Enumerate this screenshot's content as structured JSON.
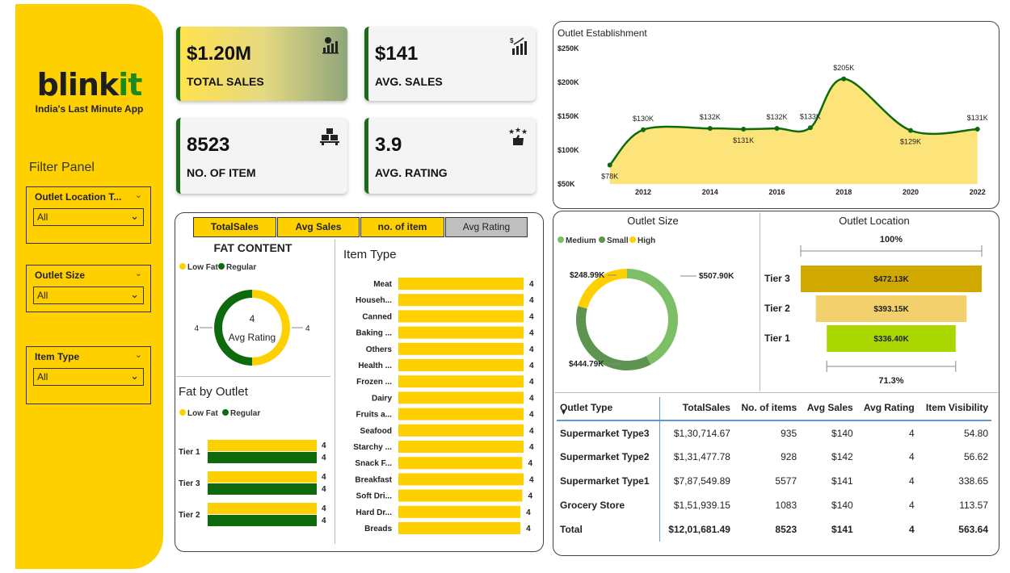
{
  "brand": {
    "name_a": "blink",
    "name_b": "it",
    "tagline": "India's Last Minute App"
  },
  "filters": {
    "title": "Filter Panel",
    "slicers": [
      {
        "label": "Outlet Location T...",
        "value": "All"
      },
      {
        "label": "Outlet Size",
        "value": "All"
      },
      {
        "label": "Item Type",
        "value": "All"
      }
    ]
  },
  "kpis": [
    {
      "value": "$1.20M",
      "label": "TOTAL SALES",
      "icon": "sales-growth-icon"
    },
    {
      "value": "$141",
      "label": "AVG. SALES",
      "icon": "dollar-bar-chart-icon"
    },
    {
      "value": "8523",
      "label": "NO. OF ITEM",
      "icon": "boxes-icon"
    },
    {
      "value": "3.9",
      "label": "AVG. RATING",
      "icon": "thumbs-up-stars-icon"
    }
  ],
  "measure_buttons": [
    "TotalSales",
    "Avg Sales",
    "no. of item",
    "Avg Rating"
  ],
  "selected_measure": "Avg Rating",
  "colors": {
    "yellow": "#ffd000",
    "green": "#0d6b0d",
    "area": "#fde47a",
    "line": "#0d6b0d"
  },
  "chart_data": [
    {
      "id": "outlet_establishment",
      "type": "area",
      "title": "Outlet Establishment",
      "x": [
        2011,
        2012,
        2014,
        2015,
        2016,
        2017,
        2018,
        2020,
        2022
      ],
      "values": [
        78,
        130,
        132,
        131,
        132,
        133,
        205,
        129,
        131
      ],
      "value_labels": [
        "$78K",
        "$130K",
        "$132K",
        "$131K",
        "$132K",
        "$133K",
        "$205K",
        "$129K",
        "$131K"
      ],
      "label_position": [
        "below",
        "above",
        "above",
        "below",
        "above",
        "above",
        "above",
        "below",
        "above"
      ],
      "x_ticks": [
        "2012",
        "2014",
        "2016",
        "2018",
        "2020",
        "2022"
      ],
      "x_tick_values": [
        2012,
        2014,
        2016,
        2018,
        2020,
        2022
      ],
      "y_ticks": [
        "$250K",
        "$200K",
        "$150K",
        "$100K",
        "$50K"
      ],
      "y_tick_values": [
        250,
        200,
        150,
        100,
        50
      ],
      "ylim": [
        50,
        250
      ],
      "xlim": [
        2010.5,
        2022.2
      ]
    },
    {
      "id": "fat_content",
      "type": "pie",
      "title": "FAT CONTENT",
      "series": [
        {
          "name": "Low Fat",
          "value": 4
        },
        {
          "name": "Regular",
          "value": 4
        }
      ],
      "center_value": "4",
      "center_label": "Avg Rating",
      "side_labels": [
        "4",
        "4"
      ]
    },
    {
      "id": "outlet_size",
      "type": "pie",
      "title": "Outlet Size",
      "series": [
        {
          "name": "Medium",
          "value": 507.9,
          "label": "$507.90K",
          "color": "#7dbf66"
        },
        {
          "name": "Small",
          "value": 444.79,
          "label": "$444.79K",
          "color": "#5c9450"
        },
        {
          "name": "High",
          "value": 248.99,
          "label": "$248.99K",
          "color": "#ffd000"
        }
      ]
    },
    {
      "id": "outlet_location",
      "type": "bar",
      "title": "Outlet Location",
      "categories": [
        "Tier 3",
        "Tier 2",
        "Tier 1"
      ],
      "values": [
        472.13,
        393.15,
        336.4
      ],
      "value_labels": [
        "$472.13K",
        "$393.15K",
        "$336.40K"
      ],
      "colors": [
        "#cfa800",
        "#f2d06b",
        "#aad700"
      ],
      "top_label": "100%",
      "bottom_label": "71.3%"
    },
    {
      "id": "fat_by_outlet",
      "type": "bar",
      "title": "Fat by Outlet",
      "categories": [
        "Tier 1",
        "Tier 3",
        "Tier 2"
      ],
      "series": [
        {
          "name": "Low Fat",
          "values": [
            4,
            4,
            4
          ]
        },
        {
          "name": "Regular",
          "values": [
            4,
            4,
            4
          ]
        }
      ],
      "xlim": [
        0,
        4
      ]
    },
    {
      "id": "item_type",
      "type": "bar",
      "title": "Item Type",
      "categories": [
        "Meat",
        "Househ...",
        "Canned",
        "Baking ...",
        "Others",
        "Health ...",
        "Frozen ...",
        "Dairy",
        "Fruits a...",
        "Seafood",
        "Starchy ...",
        "Snack F...",
        "Breakfast",
        "Soft Dri...",
        "Hard Dr...",
        "Breads"
      ],
      "values": [
        4,
        4,
        4,
        4,
        4,
        4,
        4,
        4,
        4,
        4,
        4,
        4,
        4,
        4,
        4,
        4
      ],
      "ratios": [
        1.0,
        1.0,
        1.0,
        1.0,
        1.0,
        1.0,
        1.0,
        1.0,
        1.0,
        1.0,
        1.0,
        0.99,
        1.0,
        0.99,
        0.975,
        0.975
      ]
    }
  ],
  "outlet_table": {
    "headers": [
      "Outlet Type",
      "TotalSales",
      "No. of items",
      "Avg Sales",
      "Avg Rating",
      "Item Visibility"
    ],
    "rows": [
      [
        "Supermarket Type3",
        "$1,30,714.67",
        "935",
        "$140",
        "4",
        "54.80"
      ],
      [
        "Supermarket Type2",
        "$1,31,477.78",
        "928",
        "$142",
        "4",
        "56.62"
      ],
      [
        "Supermarket Type1",
        "$7,87,549.89",
        "5577",
        "$141",
        "4",
        "338.65"
      ],
      [
        "Grocery Store",
        "$1,51,939.15",
        "1083",
        "$140",
        "4",
        "113.57"
      ]
    ],
    "total": [
      "Total",
      "$12,01,681.49",
      "8523",
      "$141",
      "4",
      "563.64"
    ]
  }
}
